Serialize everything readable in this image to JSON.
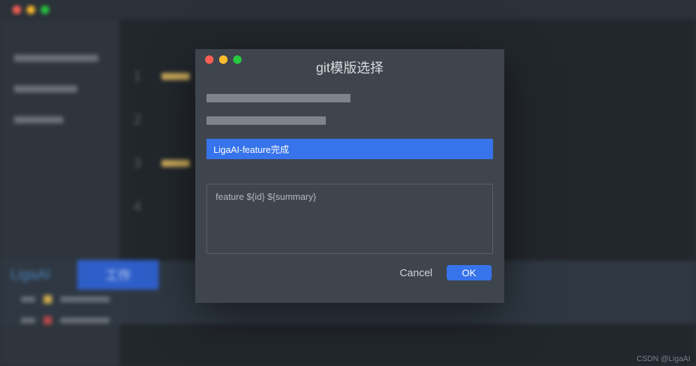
{
  "dialog": {
    "title": "git模版选择",
    "selected_template": "LigaAI-feature完成",
    "preview_text": "feature ${id} ${summary}",
    "cancel_label": "Cancel",
    "ok_label": "OK"
  },
  "background": {
    "brand": "LigaAI",
    "tab_label": "工作",
    "line_numbers": [
      "1",
      "2",
      "3",
      "4"
    ]
  },
  "watermark": "CSDN @LigaAI"
}
